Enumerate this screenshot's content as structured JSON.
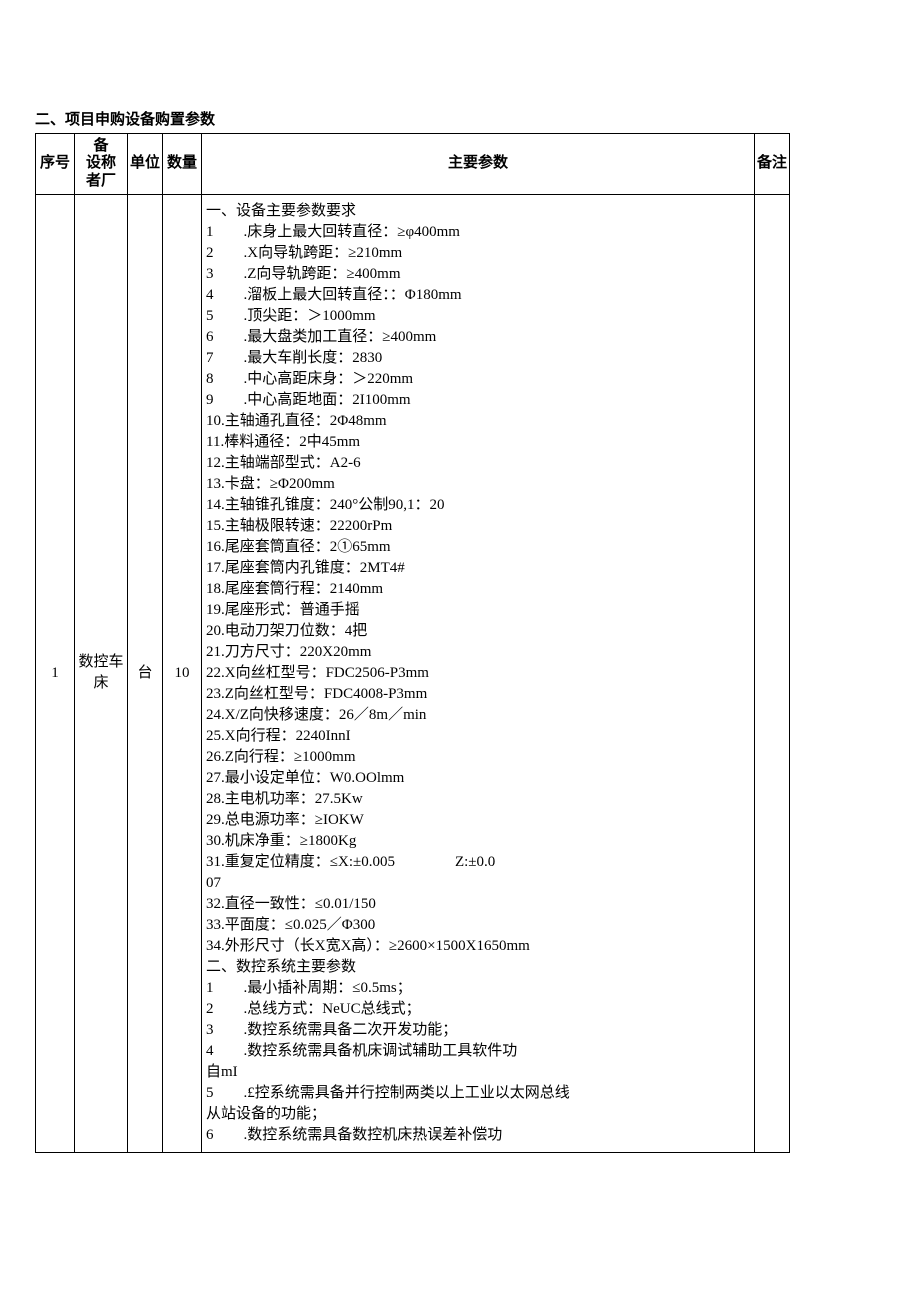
{
  "section_title": "二、项目申购设备购置参数",
  "headers": {
    "idx": "序号",
    "name_top": "备",
    "name_mid1": "设称",
    "name_mid2": "者厂",
    "unit": "单位",
    "qty": "数量",
    "spec": "主要参数",
    "note": "备注"
  },
  "row": {
    "idx": "1",
    "name": "数控车床",
    "unit": "台",
    "qty": "10",
    "note": "",
    "spec_lines": [
      "一、设备主要参数要求",
      "1　　.床身上最大回转直径：≥φ400mm",
      "2　　.X向导轨跨距：≥210mm",
      "3　　.Z向导轨跨距：≥400mm",
      "4　　.溜板上最大回转直径：：Φ180mm",
      "5　　.顶尖距：＞1000mm",
      "6　　.最大盘类加工直径：≥400mm",
      "7　　.最大车削长度：2830",
      "8　　.中心高距床身：＞220mm",
      "9　　.中心高距地面：2I100mm",
      "10.主轴通孔直径：2Φ48mm",
      "11.棒料通径：2中45mm",
      "12.主轴端部型式：A2-6",
      "13.卡盘：≥Φ200mm",
      "14.主轴锥孔锥度：240°公制90,1：20",
      "15.主轴极限转速：22200rPm",
      "16.尾座套筒直径：2①65mm",
      "17.尾座套筒内孔锥度：2MT4#",
      "18.尾座套筒行程：2140mm",
      "19.尾座形式：普通手摇",
      "20.电动刀架刀位数：4把",
      "21.刀方尺寸：220X20mm",
      "22.X向丝杠型号：FDC2506-P3mm",
      "23.Z向丝杠型号：FDC4008-P3mm",
      "24.X/Z向快移速度：26／8m／min",
      "25.X向行程：2240InnI",
      "26.Z向行程：≥1000mm",
      "27.最小设定单位：W0.OOlmm",
      "28.主电机功率：27.5Kw",
      "29.总电源功率：≥IOKW",
      "30.机床净重：≥1800Kg",
      "31.重复定位精度：≤X:±0.005　　　　Z:±0.0",
      "07",
      "32.直径一致性：≤0.01/150",
      "33.平面度：≤0.025／Φ300",
      "34.外形尺寸（长X宽X高）：≥2600×1500X1650mm",
      "二、数控系统主要参数",
      "1　　.最小插补周期：≤0.5ms；",
      "2　　.总线方式：NeUC总线式；",
      "3　　.数控系统需具备二次开发功能；",
      "4　　.数控系统需具备机床调试辅助工具软件功",
      "自mI",
      "5　　.£控系统需具备并行控制两类以上工业以太网总线",
      "从站设备的功能；",
      "6　　.数控系统需具备数控机床热误差补偿功"
    ]
  }
}
